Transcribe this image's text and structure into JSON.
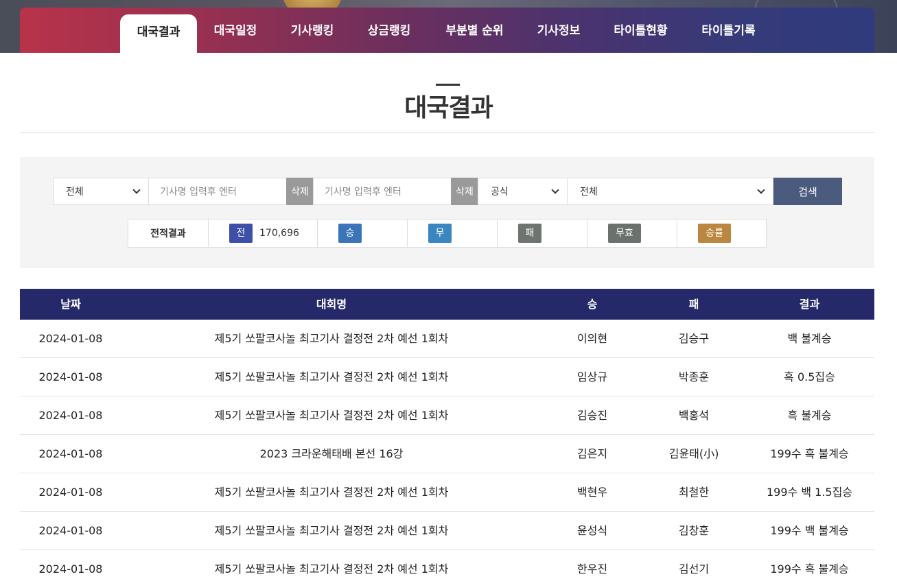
{
  "nav": {
    "items": [
      {
        "label": "대국결과",
        "active": true
      },
      {
        "label": "대국일정",
        "active": false
      },
      {
        "label": "기사랭킹",
        "active": false
      },
      {
        "label": "상금랭킹",
        "active": false
      },
      {
        "label": "부분별 순위",
        "active": false
      },
      {
        "label": "기사정보",
        "active": false
      },
      {
        "label": "타이틀현황",
        "active": false
      },
      {
        "label": "타이틀기록",
        "active": false
      }
    ]
  },
  "page": {
    "title": "대국결과"
  },
  "search": {
    "filter1": "전체",
    "player1_placeholder": "기사명 입력후 엔터",
    "delete1": "삭제",
    "player2_placeholder": "기사명 입력후 엔터",
    "delete2": "삭제",
    "type": "공식",
    "tournament": "전체",
    "search_label": "검색"
  },
  "stats": {
    "label": "전적결과",
    "total_badge": "전",
    "total_value": "170,696",
    "win_badge": "승",
    "draw_badge": "무",
    "loss_badge": "패",
    "void_badge": "무효",
    "rate_badge": "승률",
    "colors": {
      "total": "#3d4fa8",
      "win": "#3b74b8",
      "draw": "#3a86c0",
      "loss": "#6e7570",
      "void": "#6b716d",
      "rate": "#bb8740"
    }
  },
  "table": {
    "headers": {
      "date": "날짜",
      "name": "대회명",
      "win": "승",
      "lose": "패",
      "result": "결과"
    },
    "rows": [
      {
        "date": "2024-01-08",
        "name": "제5기 쏘팔코사놀 최고기사 결정전 2차 예선 1회차",
        "win": "이의현",
        "lose": "김승구",
        "result": "백 불계승"
      },
      {
        "date": "2024-01-08",
        "name": "제5기 쏘팔코사놀 최고기사 결정전 2차 예선 1회차",
        "win": "임상규",
        "lose": "박종훈",
        "result": "흑 0.5집승"
      },
      {
        "date": "2024-01-08",
        "name": "제5기 쏘팔코사놀 최고기사 결정전 2차 예선 1회차",
        "win": "김승진",
        "lose": "백홍석",
        "result": "흑 불계승"
      },
      {
        "date": "2024-01-08",
        "name": "2023 크라운해태배 본선 16강",
        "win": "김은지",
        "lose": "김윤태(小)",
        "result": "199수 흑 불계승"
      },
      {
        "date": "2024-01-08",
        "name": "제5기 쏘팔코사놀 최고기사 결정전 2차 예선 1회차",
        "win": "백현우",
        "lose": "최철한",
        "result": "199수 백 1.5집승"
      },
      {
        "date": "2024-01-08",
        "name": "제5기 쏘팔코사놀 최고기사 결정전 2차 예선 1회차",
        "win": "윤성식",
        "lose": "김창훈",
        "result": "199수 백 불계승"
      },
      {
        "date": "2024-01-08",
        "name": "제5기 쏘팔코사놀 최고기사 결정전 2차 예선 1회차",
        "win": "한우진",
        "lose": "김선기",
        "result": "199수 흑 불계승"
      }
    ]
  }
}
